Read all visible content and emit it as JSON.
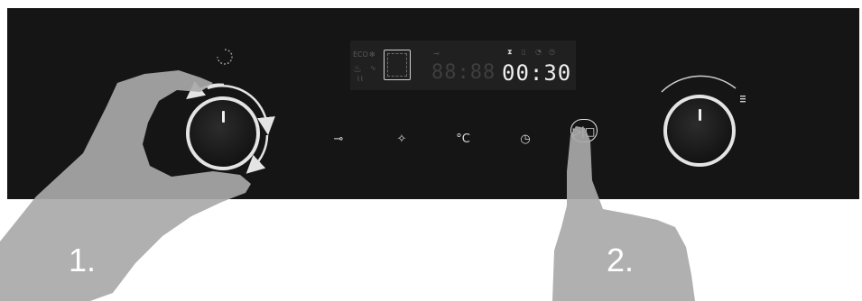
{
  "display": {
    "timer_value": "00:30",
    "inactive_digits": "88:88"
  },
  "controls": {
    "icons": [
      "key-lock-icon",
      "light-icon",
      "temperature-icon",
      "clock-icon",
      "start-stop-icon"
    ],
    "temperature_symbol": "°C",
    "start_stop_symbol": "▷|□"
  },
  "steps": {
    "step1": "1.",
    "step2": "2."
  },
  "colors": {
    "panel": "#151515",
    "hand": "#a9a9a9",
    "ring": "#e4e4e4"
  }
}
